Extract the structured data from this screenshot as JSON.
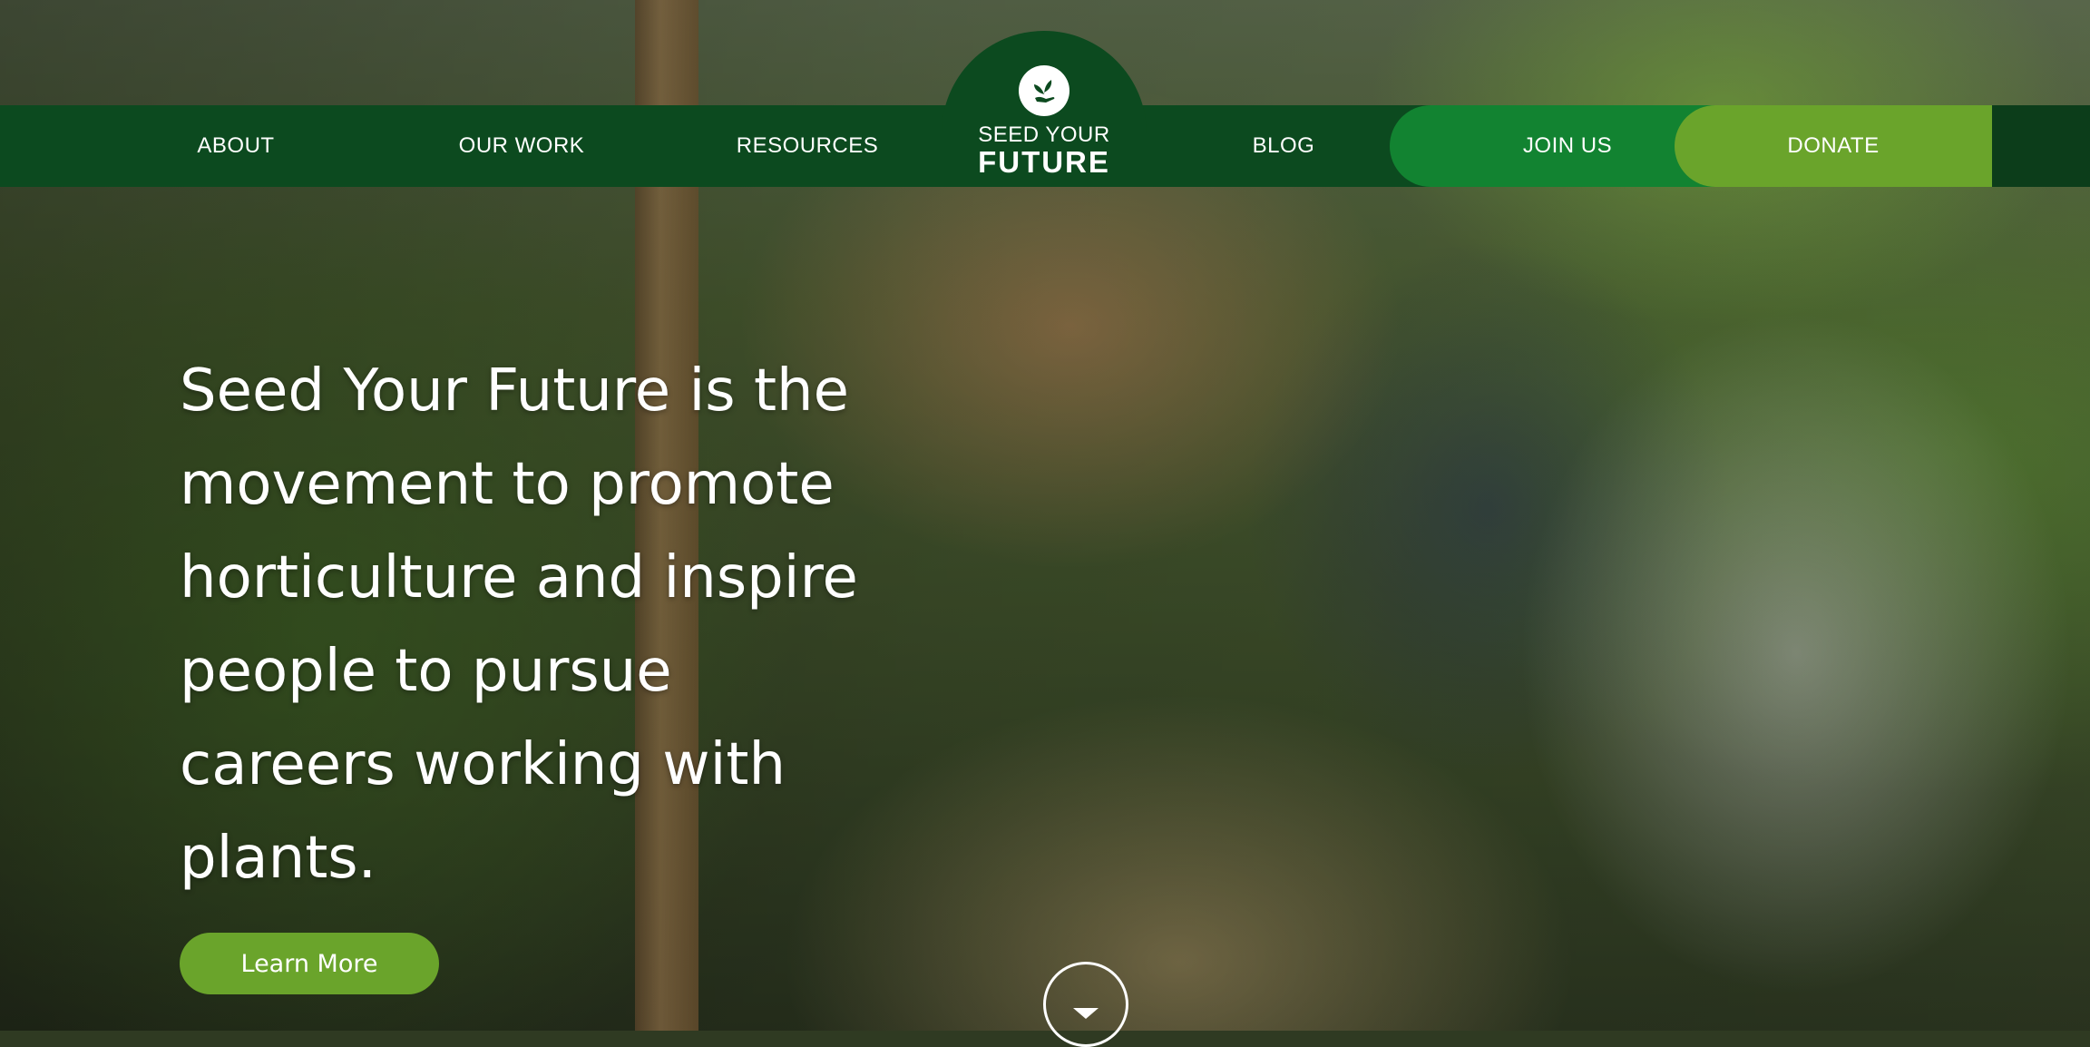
{
  "nav": {
    "about": "ABOUT",
    "our_work": "OUR WORK",
    "resources": "RESOURCES",
    "blog": "BLOG",
    "join_us": "JOIN US",
    "donate": "DONATE"
  },
  "logo": {
    "line1": "SEED YOUR",
    "line2": "FUTURE",
    "icon": "seedling-hand-icon"
  },
  "hero": {
    "headline": "Seed Your Future is the movement to promote horticulture and inspire people to pursue careers working with plants.",
    "cta_label": "Learn More",
    "scroll_icon": "chevron-down-icon"
  },
  "colors": {
    "nav_bg": "#0c4a1f",
    "join_bg": "#128331",
    "donate_bg": "#6aa42b",
    "cta_bg": "#6aa42b"
  }
}
